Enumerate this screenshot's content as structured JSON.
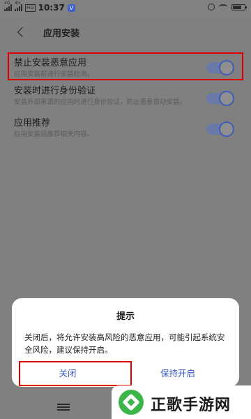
{
  "status_bar": {
    "signal1_label": "4G",
    "signal2_label": "4G",
    "hd_label": "HD",
    "time": "10:37",
    "notif_badge": "V",
    "battery_level": 0.8
  },
  "header": {
    "title": "应用安装"
  },
  "settings": [
    {
      "title": "禁止安装恶意应用",
      "desc": "应用安装前进行安装检测。",
      "enabled": true
    },
    {
      "title": "安装时进行身份验证",
      "desc": "安装外部来源的应用时进行身份验证，防止恶意自动安装。",
      "enabled": true
    },
    {
      "title": "应用推荐",
      "desc": "应用安装后推荐相关内容。",
      "enabled": true
    }
  ],
  "dialog": {
    "title": "提示",
    "message": "关闭后，将允许安装高风险的恶意应用，可能引起系统安全风险，建议保持开启。",
    "close_label": "关闭",
    "keep_label": "保持开启"
  },
  "watermark": {
    "text": "正歌手游网"
  },
  "colors": {
    "accent": "#3657c2",
    "highlight": "#e00000",
    "overlay": "#808080"
  }
}
